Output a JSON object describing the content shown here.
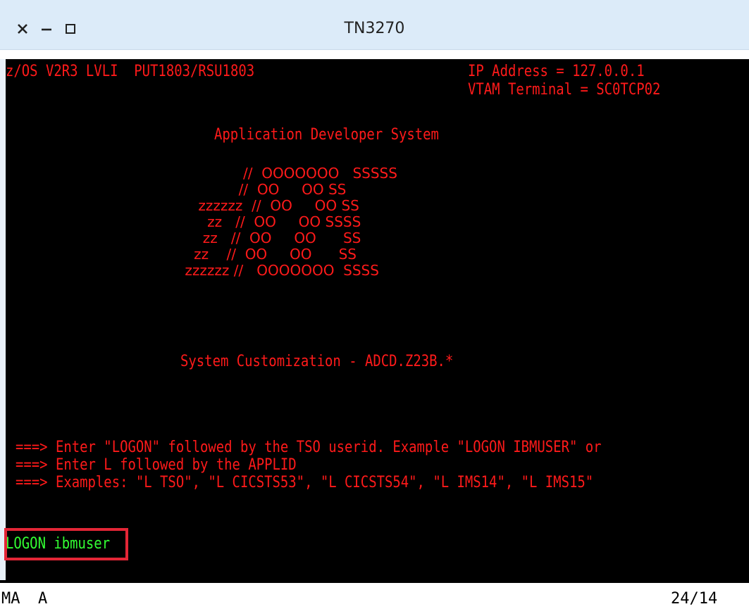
{
  "window": {
    "title": "TN3270",
    "controls": [
      "close-icon",
      "minimize-icon",
      "maximize-icon"
    ]
  },
  "terminal": {
    "header_left": "z/OS V2R3 LVLI  PUT1803/RSU1803",
    "header_ip": "IP Address = 127.0.0.1",
    "header_vtam": "VTAM Terminal = SC0TCP02",
    "heading": "Application Developer System",
    "logo": [
      "              //  OOOOOOO   SSSSS",
      "             //  OO     OO SS",
      "    zzzzzz  //  OO     OO SS",
      "      zz   //  OO     OO SSSS",
      "     zz   //  OO     OO      SS",
      "   zz    //  OO     OO      SS",
      " zzzzzz //   OOOOOOO  SSSS"
    ],
    "customization": "System Customization - ADCD.Z23B.*",
    "instructions": [
      "===> Enter \"LOGON\" followed by the TSO userid. Example \"LOGON IBMUSER\" or",
      "===> Enter L followed by the APPLID",
      "===> Examples: \"L TSO\", \"L CICSTS53\", \"L CICSTS54\", \"L IMS14\", \"L IMS15\""
    ],
    "command_input": "LOGON ibmuser"
  },
  "status": {
    "left1": "MA",
    "left2": "A",
    "cursor": "24/14"
  },
  "colors": {
    "terminal_bg": "#000000",
    "text_red": "#ff1a1a",
    "text_green": "#33ff33",
    "highlight_box": "#e32636",
    "titlebar_bg": "#dcebf9"
  }
}
